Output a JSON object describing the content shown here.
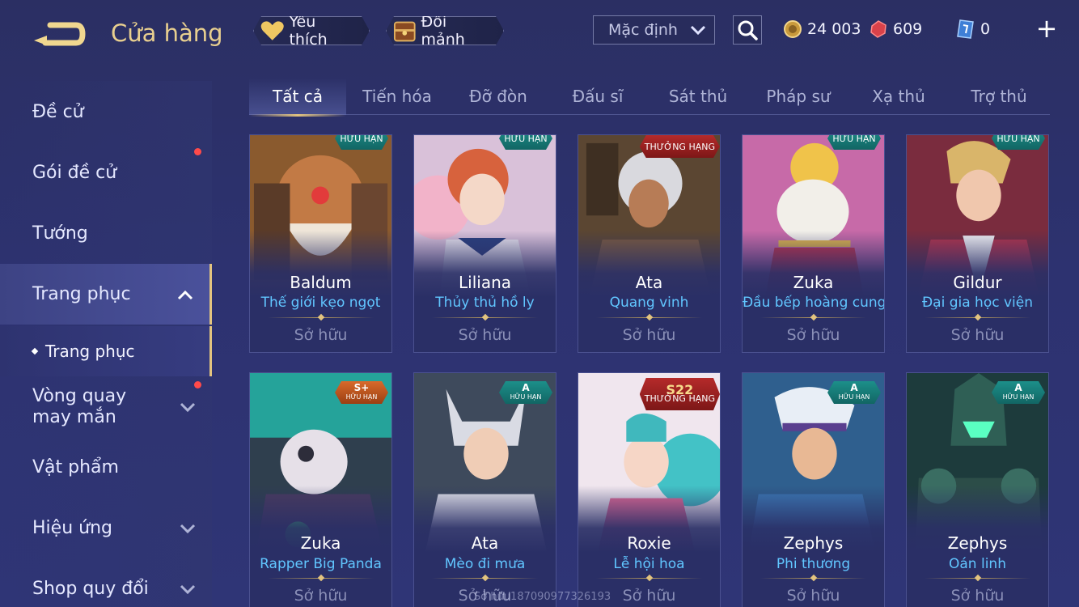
{
  "header": {
    "title": "Cửa hàng",
    "favorite_label": "Yêu thích",
    "shard_label": "Đổi mảnh",
    "sort_value": "Mặc định",
    "currencies": {
      "gold": "24 003",
      "gem": "609",
      "ticket": "0"
    }
  },
  "sidebar": {
    "items": [
      {
        "label": "Đề cử"
      },
      {
        "label": "Gói đề cử"
      },
      {
        "label": "Tướng"
      },
      {
        "label": "Trang phục"
      },
      {
        "label": "Trang phục"
      },
      {
        "label": "Vòng quay may mắn"
      },
      {
        "label": "Vật phẩm"
      },
      {
        "label": "Hiệu ứng"
      },
      {
        "label": "Shop quy đổi"
      }
    ]
  },
  "tabs": [
    "Tất cả",
    "Tiến hóa",
    "Đỡ đòn",
    "Đấu sĩ",
    "Sát thủ",
    "Pháp sư",
    "Xạ thủ",
    "Trợ thủ"
  ],
  "cards": [
    {
      "hero": "Baldum",
      "skin": "Thế giới kẹo ngọt",
      "status": "Sở hữu",
      "badge_top": "",
      "badge_bottom": "HỮU HẠN"
    },
    {
      "hero": "Liliana",
      "skin": "Thủy thủ hồ ly",
      "status": "Sở hữu",
      "badge_top": "",
      "badge_bottom": "HỮU HẠN"
    },
    {
      "hero": "Ata",
      "skin": "Quang vinh",
      "status": "Sở hữu",
      "badge_top": "",
      "badge_bottom": "THƯỞNG HẠNG"
    },
    {
      "hero": "Zuka",
      "skin": "Đầu bếp hoàng cung",
      "status": "Sở hữu",
      "badge_top": "",
      "badge_bottom": "HỮU HẠN"
    },
    {
      "hero": "Gildur",
      "skin": "Đại gia học viện",
      "status": "Sở hữu",
      "badge_top": "",
      "badge_bottom": "HỮU HẠN"
    },
    {
      "hero": "Zuka",
      "skin": "Rapper Big Panda",
      "status": "Sở hữu",
      "badge_top": "S+",
      "badge_bottom": "HỮU HẠN"
    },
    {
      "hero": "Ata",
      "skin": "Mèo đi mưa",
      "status": "Sở hữu",
      "badge_top": "A",
      "badge_bottom": "HỮU HẠN"
    },
    {
      "hero": "Roxie",
      "skin": "Lễ hội hoa",
      "status": "Sở hữu",
      "badge_top": "S22",
      "badge_bottom": "THƯỞNG HẠNG"
    },
    {
      "hero": "Zephys",
      "skin": "Phi thương",
      "status": "Sở hữu",
      "badge_top": "A",
      "badge_bottom": "HỮU HẠN"
    },
    {
      "hero": "Zephys",
      "skin": "Oán linh",
      "status": "Sở hữu",
      "badge_top": "A",
      "badge_bottom": "HỮU HẠN"
    }
  ],
  "watermark": "Sở hữu187090977326193",
  "colors": {
    "accent_gold": "#e3c47f",
    "skin_name": "#61c6ff",
    "notification": "#ff4a4a",
    "background": "#2d3270"
  },
  "icons": [
    "back-arrow-icon",
    "heart-icon",
    "chest-icon",
    "chevron-down-icon",
    "search-icon",
    "gold-coin-icon",
    "red-gem-icon",
    "ticket-icon",
    "plus-icon",
    "chevron-up-icon"
  ]
}
